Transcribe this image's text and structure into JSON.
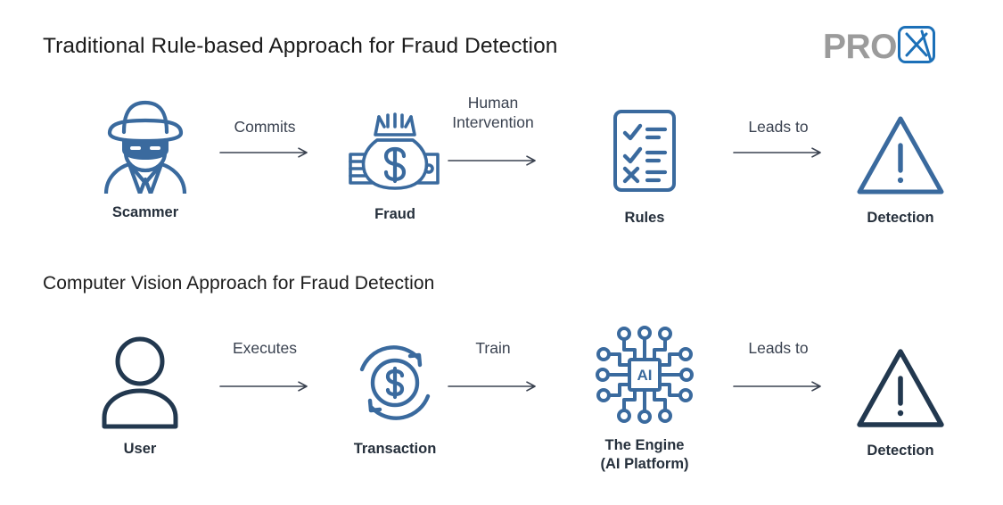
{
  "brand": {
    "text": "PRO",
    "mark_letter": "X",
    "gray": "#9b9b9b",
    "blue": "#1c70b8"
  },
  "colors": {
    "steel_blue": "#3a6a9e",
    "navy": "#22384f",
    "title_text": "#1b1b1b",
    "caption_text": "#26303c",
    "arrow_text": "#3a4250",
    "background": "#ffffff"
  },
  "sections": [
    {
      "title": "Traditional Rule-based Approach for Fraud Detection",
      "nodes": [
        {
          "caption": "Scammer",
          "icon": "scammer-icon"
        },
        {
          "caption": "Fraud",
          "icon": "money-bag-icon"
        },
        {
          "caption": "Rules",
          "icon": "checklist-icon"
        },
        {
          "caption": "Detection",
          "icon": "warning-triangle-icon"
        }
      ],
      "arrows": [
        {
          "label": "Commits",
          "icon": "arrow-right-icon"
        },
        {
          "label": "Human\nIntervention",
          "label_line_1": "Human",
          "label_line_2": "Intervention",
          "icon": "arrow-right-icon"
        },
        {
          "label": "Leads to",
          "icon": "arrow-right-icon"
        }
      ]
    },
    {
      "title": "Computer Vision Approach for Fraud Detection",
      "nodes": [
        {
          "caption": "User",
          "icon": "person-icon"
        },
        {
          "caption": "Transaction",
          "icon": "transaction-cycle-icon"
        },
        {
          "caption": "The Engine",
          "caption_line_2": "(AI Platform)",
          "icon": "ai-chip-icon"
        },
        {
          "caption": "Detection",
          "icon": "warning-triangle-icon"
        }
      ],
      "arrows": [
        {
          "label": "Executes",
          "icon": "arrow-right-icon"
        },
        {
          "label": "Train",
          "icon": "arrow-right-icon"
        },
        {
          "label": "Leads to",
          "icon": "arrow-right-icon"
        }
      ]
    }
  ]
}
